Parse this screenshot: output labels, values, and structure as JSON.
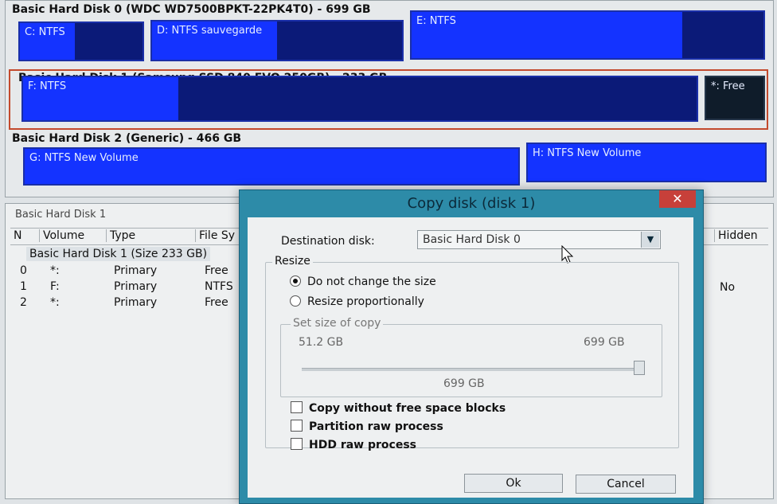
{
  "disks": [
    {
      "title": "Basic Hard Disk 0 (WDC WD7500BPKT-22PK4T0) - 699 GB",
      "partitions": [
        {
          "label": "C: NTFS",
          "used": 0.45
        },
        {
          "label": "D: NTFS sauvegarde",
          "used": 0.5
        },
        {
          "label": "E: NTFS",
          "used": 0.77
        }
      ]
    },
    {
      "title": "Basic Hard Disk 1 (Samsung SSD 840 EVO 250GB) - 233 GB",
      "partitions": [
        {
          "label": "F: NTFS",
          "used": 0.23
        },
        {
          "label": "*: Free",
          "used": 0
        }
      ]
    },
    {
      "title": "Basic Hard Disk 2 (Generic) - 466 GB",
      "partitions": [
        {
          "label": "G: NTFS New Volume",
          "used": 0.02
        },
        {
          "label": "H: NTFS New Volume",
          "used": 0.02
        }
      ]
    }
  ],
  "list": {
    "caption": "Basic Hard Disk 1",
    "columns": [
      "N",
      "Volume",
      "Type",
      "File Sy",
      "Hidden"
    ],
    "group": "Basic Hard Disk 1 (Size 233 GB)",
    "rows": [
      {
        "n": "0",
        "volume": "*:",
        "type": "Primary",
        "fs": "Free"
      },
      {
        "n": "1",
        "volume": "F:",
        "type": "Primary",
        "fs": "NTFS"
      },
      {
        "n": "2",
        "volume": "*:",
        "type": "Primary",
        "fs": "Free"
      }
    ],
    "hidden_value": "No"
  },
  "dialog": {
    "title": "Copy disk (disk 1)",
    "close": "✕",
    "destination_label": "Destination disk:",
    "destination_value": "Basic Hard Disk 0",
    "resize_label": "Resize",
    "radio_keep": "Do not change the size",
    "radio_prop": "Resize proportionally",
    "size_group_label": "Set size of copy",
    "size_min": "51.2 GB",
    "size_max": "699 GB",
    "size_current": "699 GB",
    "slider_value_fraction": 1.0,
    "check_free_blocks": "Copy without free space blocks",
    "check_partition_raw": "Partition raw process",
    "check_hdd_raw": "HDD raw process",
    "ok": "Ok",
    "cancel": "Cancel"
  }
}
